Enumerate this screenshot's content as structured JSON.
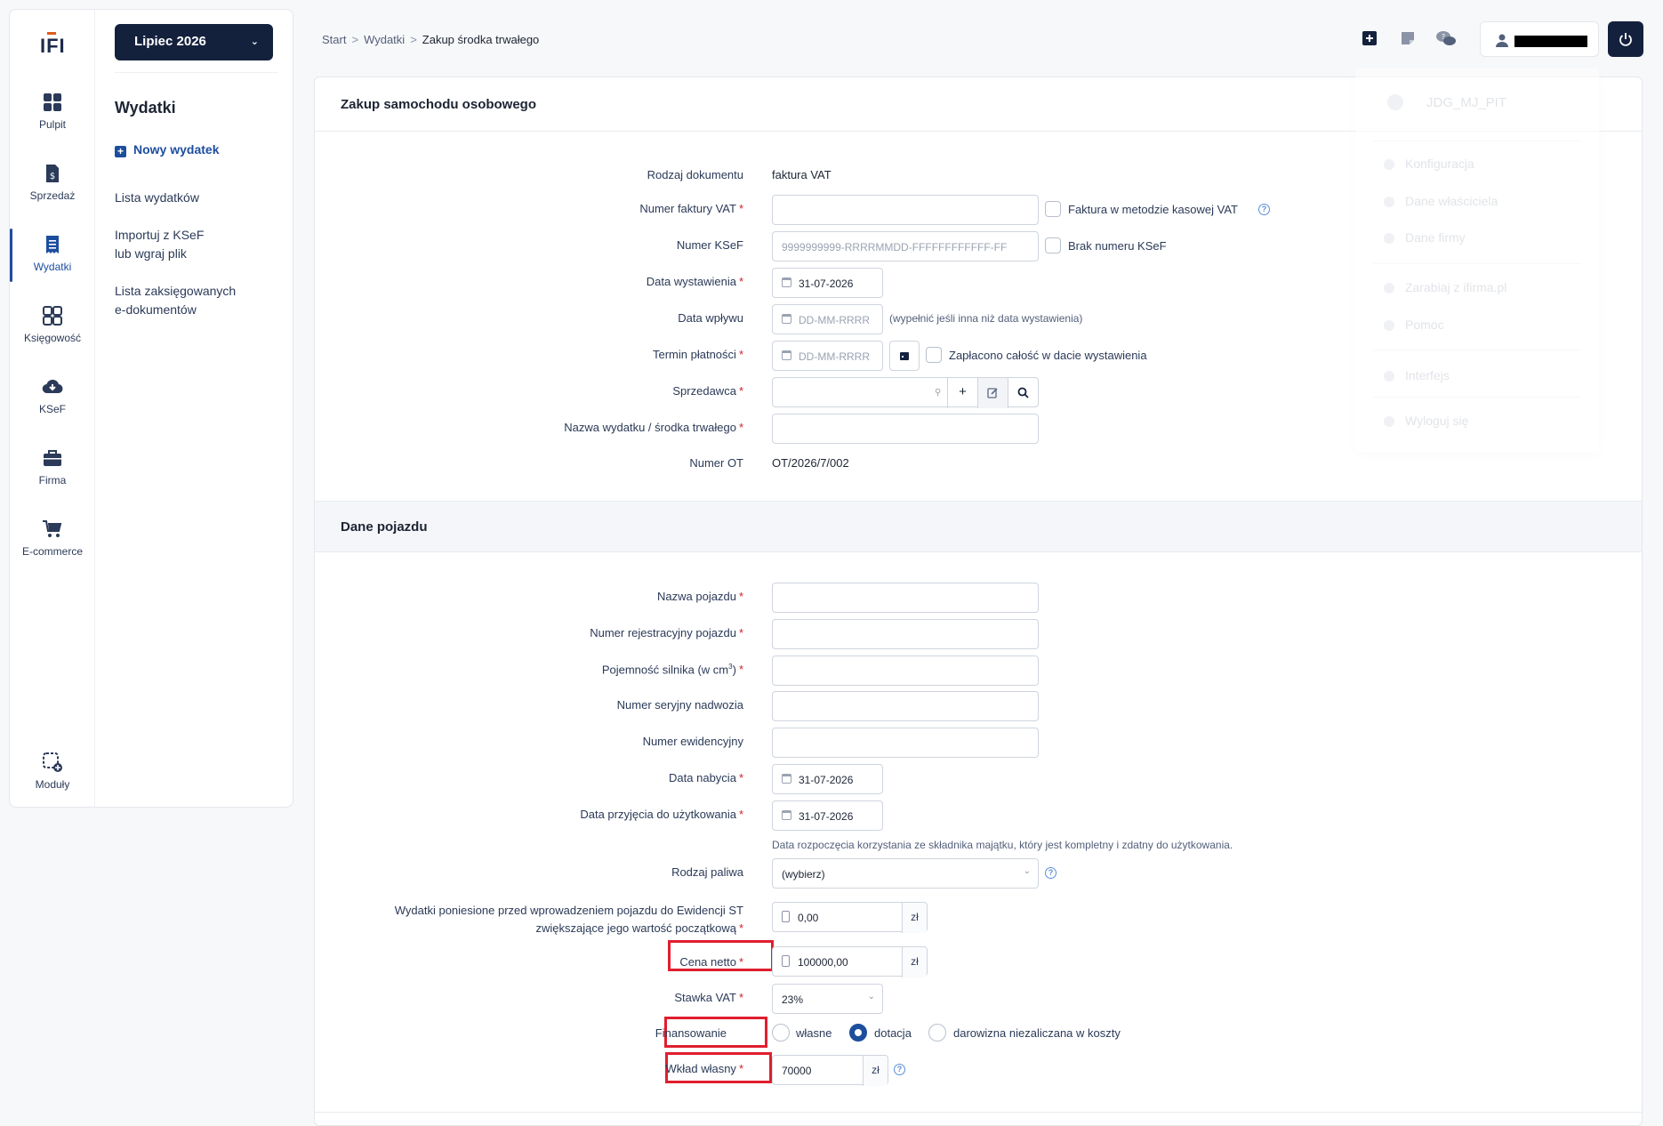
{
  "rail": {
    "logo": "IFI",
    "items": [
      {
        "label": "Pulpit",
        "icon": "dashboard-icon"
      },
      {
        "label": "Sprzedaż",
        "icon": "invoice-dollar-icon"
      },
      {
        "label": "Wydatki",
        "icon": "receipt-icon"
      },
      {
        "label": "Księgowość",
        "icon": "calculator-icon"
      },
      {
        "label": "KSeF",
        "icon": "cloud-download-icon"
      },
      {
        "label": "Firma",
        "icon": "briefcase-icon"
      },
      {
        "label": "E-commerce",
        "icon": "cart-icon"
      },
      {
        "label": "Moduły",
        "icon": "module-add-icon"
      }
    ],
    "active": "Wydatki"
  },
  "side": {
    "month": "Lipiec 2026",
    "title": "Wydatki",
    "new_expense": "Nowy wydatek",
    "links": [
      "Lista wydatków",
      "Importuj z KSeF\nlub wgraj plik",
      "Lista zaksięgowanych\ne-dokumentów"
    ]
  },
  "breadcrumb": {
    "items": [
      "Start",
      "Wydatki"
    ],
    "current": "Zakup środka trwałego",
    "separator": ">"
  },
  "menu": {
    "user": "JDG_MJ_PIT",
    "items": [
      "Konfiguracja",
      "Dane właściciela",
      "Dane firmy",
      "Zarabiaj z ifirma.pl",
      "Pomoc",
      "Interfejs",
      "Wyloguj się"
    ]
  },
  "form": {
    "title": "Zakup samochodu osobowego",
    "doc_type_label": "Rodzaj dokumentu",
    "doc_type_value": "faktura VAT",
    "invoice_no_label": "Numer faktury VAT",
    "cash_vat_label": "Faktura w metodzie kasowej VAT",
    "ksef_label": "Numer KSeF",
    "ksef_placeholder": "9999999999-RRRRMMDD-FFFFFFFFFFFF-FF",
    "no_ksef_label": "Brak numeru KSeF",
    "issue_date_label": "Data wystawienia",
    "issue_date": "31-07-2026",
    "receipt_date_label": "Data wpływu",
    "date_placeholder": "DD-MM-RRRR",
    "receipt_hint": "(wypełnić jeśli inna niż data wystawienia)",
    "due_label": "Termin płatności",
    "paid_label": "Zapłacono całość w dacie wystawienia",
    "seller_label": "Sprzedawca",
    "expense_name_label": "Nazwa wydatku / środka trwałego",
    "ot_label": "Numer OT",
    "ot_value": "OT/2026/7/002"
  },
  "vehicle": {
    "title": "Dane pojazdu",
    "name_label": "Nazwa pojazdu",
    "reg_label": "Numer rejestracyjny pojazdu",
    "engine_label": "Pojemność silnika (w cm",
    "engine_sup": "3",
    "engine_close": ")",
    "vin_label": "Numer seryjny nadwozia",
    "evid_label": "Numer ewidencyjny",
    "acq_label": "Data nabycia",
    "acq_date": "31-07-2026",
    "use_label": "Data przyjęcia do użytkowania",
    "use_date": "31-07-2026",
    "use_hint": "Data rozpoczęcia korzystania ze składnika majątku, który jest kompletny i zdatny do użytkowania.",
    "fuel_label": "Rodzaj paliwa",
    "fuel_value": "(wybierz)",
    "pre_label_1": "Wydatki poniesione przed wprowadzeniem pojazdu do Ewidencji ST",
    "pre_label_2": "zwiększające jego wartość początkową",
    "pre_value": "0,00",
    "currency": "zł",
    "net_label": "Cena netto",
    "net_value": "100000,00",
    "vat_label": "Stawka VAT",
    "vat_value": "23%",
    "fin_label": "Finansowanie",
    "fin_options": [
      "własne",
      "dotacja",
      "darowizna niezaliczana w koszty"
    ],
    "fin_selected": "dotacja",
    "own_label": "Wkład własny",
    "own_value": "70000"
  },
  "colors": {
    "brand": "#14213d",
    "accent": "#1d4e9e",
    "required": "#d0202a",
    "highlight": "#e01e2e"
  }
}
